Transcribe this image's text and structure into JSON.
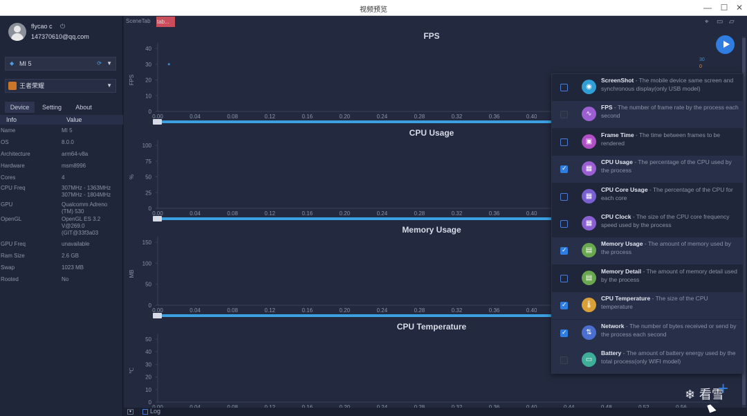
{
  "window": {
    "title": "视频预览",
    "minimize": "—",
    "maximize": "☐",
    "close": "✕"
  },
  "user": {
    "name": "flycao c",
    "email": "147370610@qq.com"
  },
  "device_select": {
    "value": "MI 5"
  },
  "app_select": {
    "value": "王者荣耀"
  },
  "tabs": [
    {
      "label": "Device"
    },
    {
      "label": "Setting"
    },
    {
      "label": "About"
    }
  ],
  "info_table": {
    "headers": [
      "Info",
      "Value"
    ],
    "rows": [
      {
        "k": "Name",
        "v": "MI 5"
      },
      {
        "k": "OS",
        "v": "8.0.0"
      },
      {
        "k": "Architecture",
        "v": "arm64-v8a"
      },
      {
        "k": "Hardware",
        "v": "msm8996"
      },
      {
        "k": "Cores",
        "v": "4"
      },
      {
        "k": "CPU Freq",
        "v": "307MHz - 1363MHz\n307MHz - 1804MHz"
      },
      {
        "k": "GPU",
        "v": "Qualcomm Adreno\n(TM) 530"
      },
      {
        "k": "OpenGL",
        "v": "OpenGL ES 3.2\nV@269.0\n(GIT@33f3a03"
      },
      {
        "k": "GPU Freq",
        "v": "unavailable"
      },
      {
        "k": "Ram Size",
        "v": "2.6 GB"
      },
      {
        "k": "Swap",
        "v": "1023 MB"
      },
      {
        "k": "Rooted",
        "v": "No"
      }
    ]
  },
  "scene": {
    "label": "SceneTab",
    "active_tab": "tab..."
  },
  "legend": {
    "fps_value": "30",
    "zero_value": "0"
  },
  "accent": "#2f7de0",
  "chart_data": [
    {
      "type": "line",
      "title": "FPS",
      "ylabel": "FPS",
      "ylim": [
        0,
        40
      ],
      "yticks": [
        0,
        10,
        20,
        30,
        40
      ],
      "x": [
        0.012
      ],
      "values": [
        30
      ],
      "xticks": [
        "0.00",
        "0.04",
        "0.08",
        "0.12",
        "0.16",
        "0.20",
        "0.24",
        "0.28",
        "0.32",
        "0.36",
        "0.40"
      ]
    },
    {
      "type": "line",
      "title": "CPU Usage",
      "ylabel": "%",
      "ylim": [
        0,
        100
      ],
      "yticks": [
        0,
        25,
        50,
        75,
        100
      ],
      "x": [],
      "values": [],
      "xticks": [
        "0.00",
        "0.04",
        "0.08",
        "0.12",
        "0.16",
        "0.20",
        "0.24",
        "0.28",
        "0.32",
        "0.36",
        "0.40"
      ]
    },
    {
      "type": "line",
      "title": "Memory Usage",
      "ylabel": "MB",
      "ylim": [
        0,
        150
      ],
      "yticks": [
        0,
        50,
        100,
        150
      ],
      "x": [],
      "values": [],
      "xticks": [
        "0.00",
        "0.04",
        "0.08",
        "0.12",
        "0.16",
        "0.20",
        "0.24",
        "0.28",
        "0.32",
        "0.36",
        "0.40"
      ]
    },
    {
      "type": "line",
      "title": "CPU Temperature",
      "ylabel": "℃",
      "ylim": [
        0,
        50
      ],
      "yticks": [
        0,
        10,
        20,
        30,
        40,
        50
      ],
      "x": [],
      "values": [],
      "xticks": [
        "0.00",
        "0.04",
        "0.08",
        "0.12",
        "0.16",
        "0.20",
        "0.24",
        "0.28",
        "0.32",
        "0.36",
        "0.40",
        "0.44",
        "0.48",
        "0.52",
        "0.56"
      ]
    }
  ],
  "metrics": [
    {
      "name": "ScreenShot",
      "desc": " - The mobile device same screen and synchronous display(only USB model)",
      "state": "off",
      "color": "#2f9fd6",
      "icon": "camera-icon",
      "glyph": "◉"
    },
    {
      "name": "FPS",
      "desc": " - The number of frame rate by the process each second",
      "state": "disabled",
      "color": "#9b5fd1",
      "icon": "pulse-icon",
      "glyph": "∿"
    },
    {
      "name": "Frame Time",
      "desc": " - The time between frames to be rendered",
      "state": "off",
      "color": "#b14fc4",
      "icon": "frame-icon",
      "glyph": "▣"
    },
    {
      "name": "CPU Usage",
      "desc": " - The percentage of the CPU used by the process",
      "state": "on",
      "color": "#9b5fd1",
      "icon": "cpu-icon",
      "glyph": "▦"
    },
    {
      "name": "CPU Core Usage",
      "desc": " - The percentage of the CPU for each core",
      "state": "off",
      "color": "#7a5fd1",
      "icon": "cpu-core-icon",
      "glyph": "▦"
    },
    {
      "name": "CPU Clock",
      "desc": " - The size of the CPU core frequency speed used by the process",
      "state": "off",
      "color": "#8a5fd1",
      "icon": "clock-icon",
      "glyph": "▦"
    },
    {
      "name": "Memory Usage",
      "desc": " - The amount of memory used by the process",
      "state": "on",
      "color": "#6aa84f",
      "icon": "memory-icon",
      "glyph": "▤"
    },
    {
      "name": "Memory Detail",
      "desc": " - The amount of memory detail used by the process",
      "state": "off",
      "color": "#6aa84f",
      "icon": "memory-detail-icon",
      "glyph": "▤"
    },
    {
      "name": "CPU Temperature",
      "desc": " - The size of the CPU temperature",
      "state": "on",
      "color": "#d8a036",
      "icon": "thermometer-icon",
      "glyph": "🌡"
    },
    {
      "name": "Network",
      "desc": " - The number of bytes received or send by the process each second",
      "state": "on",
      "color": "#4a6fd1",
      "icon": "network-icon",
      "glyph": "⇅"
    },
    {
      "name": "Battery",
      "desc": " - The amount of battery energy used by the total process(only WIFI model)",
      "state": "disabled",
      "color": "#3fae98",
      "icon": "battery-icon",
      "glyph": "▭"
    }
  ],
  "bottom": {
    "log_label": "Log",
    "expand": "▾"
  },
  "watermark": {
    "text": "看雪"
  }
}
